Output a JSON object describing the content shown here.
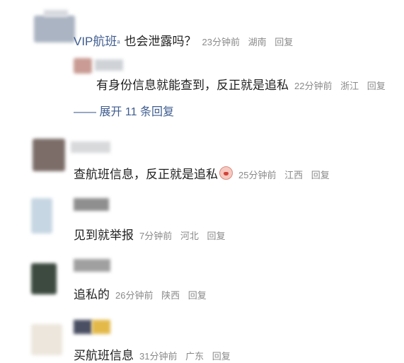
{
  "comments": [
    {
      "author_fragment": "VIP航班",
      "author_suffix": "ᵃ",
      "text": "也会泄露吗？",
      "time": "23分钟前",
      "location": "湖南",
      "reply_label": "回复"
    },
    {
      "text": "有身份信息就能查到，反正就是追私",
      "time": "22分钟前",
      "location": "浙江",
      "reply_label": "回复"
    },
    {
      "expand_label": "—— 展开 11 条回复"
    },
    {
      "text": "查航班信息，反正就是追私",
      "emoji": "scream-emoji",
      "time": "25分钟前",
      "location": "江西",
      "reply_label": "回复"
    },
    {
      "text": "见到就举报",
      "time": "7分钟前",
      "location": "河北",
      "reply_label": "回复"
    },
    {
      "text": "追私的",
      "time": "26分钟前",
      "location": "陕西",
      "reply_label": "回复"
    },
    {
      "text": "买航班信息",
      "time": "31分钟前",
      "location": "广东",
      "reply_label": "回复"
    }
  ],
  "colors": {
    "link": "#3f5d8f",
    "meta": "#8a8a8a",
    "text": "#1f1f1f"
  }
}
